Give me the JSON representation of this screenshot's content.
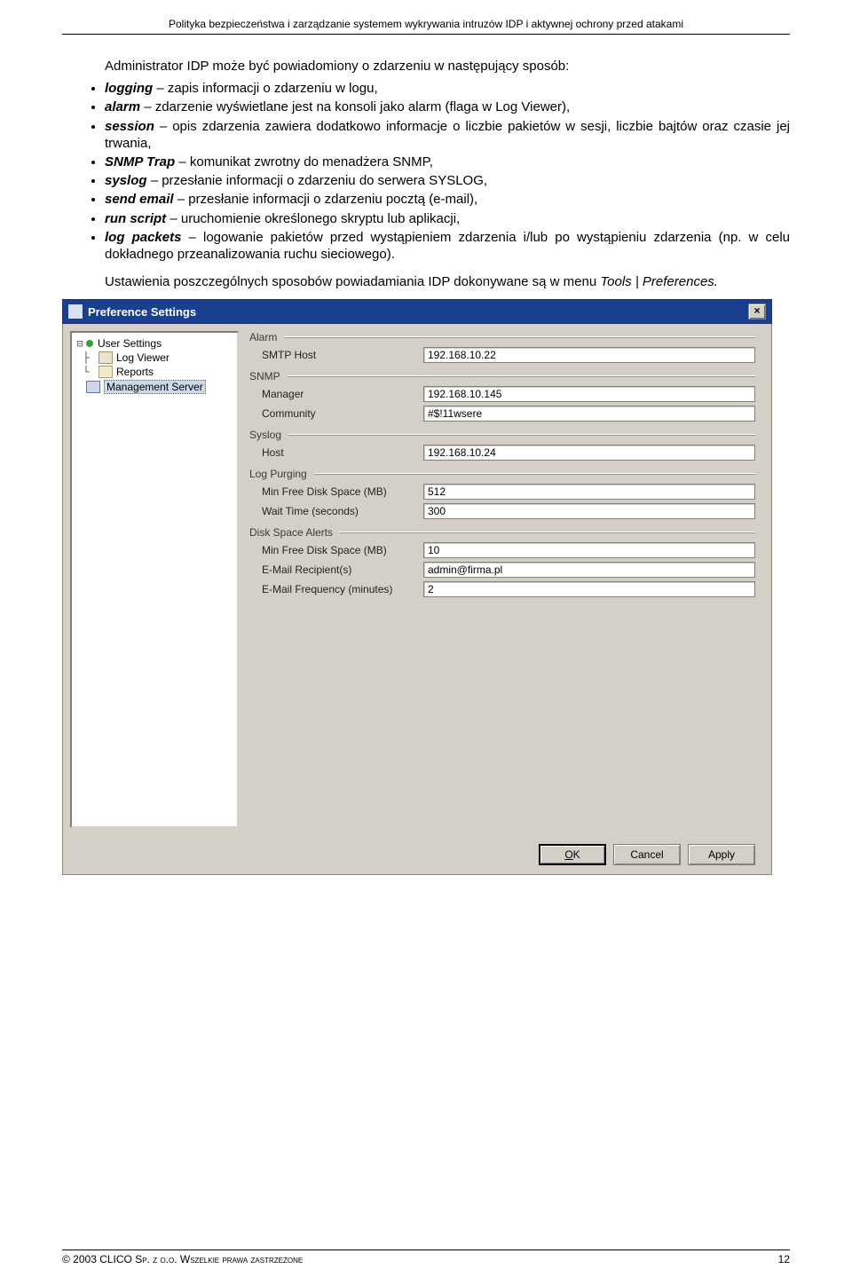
{
  "header": "Polityka bezpieczeństwa i zarządzanie systemem wykrywania intruzów IDP i aktywnej ochrony przed atakami",
  "intro": "Administrator IDP może być powiadomiony o zdarzeniu w następujący sposób:",
  "bullets": [
    {
      "term": "logging",
      "text": " – zapis informacji o zdarzeniu w logu,"
    },
    {
      "term": "alarm",
      "text": " – zdarzenie wyświetlane jest na konsoli jako alarm (flaga w Log Viewer),"
    },
    {
      "term": "session",
      "text": " – opis zdarzenia zawiera dodatkowo informacje o liczbie pakietów w sesji, liczbie bajtów oraz czasie jej trwania,"
    },
    {
      "term": "SNMP Trap",
      "text": " – komunikat zwrotny do menadżera SNMP,"
    },
    {
      "term": "syslog",
      "text": " – przesłanie informacji o zdarzeniu do serwera SYSLOG,"
    },
    {
      "term": "send email",
      "text": " – przesłanie informacji o zdarzeniu pocztą (e-mail),"
    },
    {
      "term": "run script",
      "text": " – uruchomienie określonego skryptu lub aplikacji,"
    },
    {
      "term": "log packets",
      "text": " – logowanie pakietów przed wystąpieniem zdarzenia i/lub po wystąpieniu zdarzenia (np. w celu dokładnego przeanalizowania ruchu sieciowego)."
    }
  ],
  "para2_a": "Ustawienia poszczególnych sposobów powiadamiania IDP dokonywane są w menu ",
  "para2_b": "Tools | Preferences.",
  "dialog": {
    "title": "Preference Settings",
    "close": "×",
    "tree": {
      "minus": "⊟",
      "user_settings": "User Settings",
      "log_viewer": "Log Viewer",
      "reports": "Reports",
      "management_server": "Management Server"
    },
    "groups": {
      "alarm": "Alarm",
      "snmp": "SNMP",
      "syslog": "Syslog",
      "log_purging": "Log Purging",
      "disk_alerts": "Disk Space Alerts"
    },
    "labels": {
      "smtp_host": "SMTP Host",
      "manager": "Manager",
      "community": "Community",
      "host": "Host",
      "min_free_mb": "Min Free Disk Space (MB)",
      "wait_time": "Wait Time (seconds)",
      "email_recip": "E-Mail Recipient(s)",
      "email_freq": "E-Mail Frequency (minutes)"
    },
    "values": {
      "smtp_host": "192.168.10.22",
      "manager": "192.168.10.145",
      "community": "#$!11wsere",
      "host": "192.168.10.24",
      "lp_min_free": "512",
      "lp_wait": "300",
      "da_min_free": "10",
      "da_email_recip": "admin@firma.pl",
      "da_email_freq": "2"
    },
    "buttons": {
      "ok": "OK",
      "cancel": "Cancel",
      "apply": "Apply"
    }
  },
  "footer": {
    "left_a": "© 2003 CLICO ",
    "left_b": "Sp. z o.o. Wszelkie prawa zastrzeżone",
    "page_no": "12"
  }
}
